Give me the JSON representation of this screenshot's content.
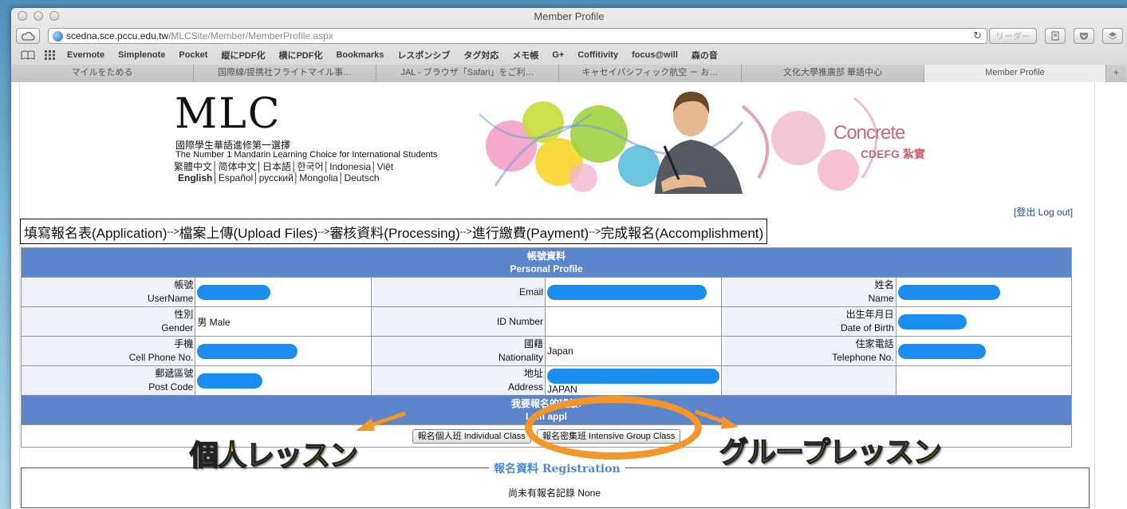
{
  "window": {
    "title": "Member Profile"
  },
  "toolbar": {
    "url_host": "scedna.sce.pccu.edu.tw",
    "url_path": "/MLCSite/Member/MemberProfile.aspx",
    "reader_label": "リーダー"
  },
  "bookmarks": [
    "Evernote",
    "Simplenote",
    "Pocket",
    "縦にPDF化",
    "横にPDF化",
    "Bookmarks",
    "レスポンシブ",
    "タグ対応",
    "メモ帳",
    "G+",
    "Coffitivity",
    "focus@will",
    "森の音"
  ],
  "tabs": [
    {
      "label": "マイルをためる",
      "active": false
    },
    {
      "label": "国際線/提携社フライトマイル事…",
      "active": false
    },
    {
      "label": "JAL - ブラウザ「Safari」をご利…",
      "active": false
    },
    {
      "label": "キャセイパシフィック航空 ー お…",
      "active": false
    },
    {
      "label": "文化大學推廣部 華語中心",
      "active": false
    },
    {
      "label": "Member Profile",
      "active": true
    }
  ],
  "site": {
    "logo": "MLC",
    "tagline_zh": "國際學生華語進修第一選擇",
    "tagline_en": "The Number 1 Mandarin Learning Choice for International Students",
    "lang_row1": "繁體中文│简体中文│日本語│한국어│Indonesia│Việt",
    "lang_row2_english": "English",
    "lang_row2_rest": "│Español│русский│Mongolia│Deutsch",
    "banner_brand": "Concrete",
    "banner_sub": "CDEFG 紮實",
    "logout": "[登出 Log out]"
  },
  "steps": {
    "s1": "填寫報名表(Application)",
    "s2": "檔案上傳(Upload Files)",
    "s3": "審核資料(Processing)",
    "s4": "進行繳費(Payment)",
    "s5": "完成報名(Accomplishment)",
    "arrow": "-->"
  },
  "profile": {
    "header_zh": "帳號資料",
    "header_en": "Personal Profile",
    "username_zh": "帳號",
    "username_en": "UserName",
    "email_label": "Email",
    "name_zh": "姓名",
    "name_en": "Name",
    "gender_zh": "性別",
    "gender_en": "Gender",
    "gender_value": "男 Male",
    "idnumber_label": "ID Number",
    "dob_zh": "出生年月日",
    "dob_en": "Date of Birth",
    "cell_zh": "手機",
    "cell_en": "Cell Phone No.",
    "nationality_zh": "國藉",
    "nationality_en": "Nationality",
    "nationality_value": "Japan",
    "tel_zh": "住家電話",
    "tel_en": "Telephone No.",
    "post_zh": "郵遞區號",
    "post_en": "Post Code",
    "address_zh": "地址",
    "address_en": "Address",
    "address_value": "JAPAN",
    "class_header_zh": "我要報名的班級:",
    "class_header_en": "I am appl",
    "individual_button": "報名個人班 Individual Class",
    "group_button": "報名密集班 Intensive Group Class"
  },
  "registration": {
    "title": "報名資料 Registration",
    "none_text": "尚未有報名記錄 None"
  },
  "annotations": {
    "left": "個人レッスン",
    "right": "グループレッスン"
  }
}
